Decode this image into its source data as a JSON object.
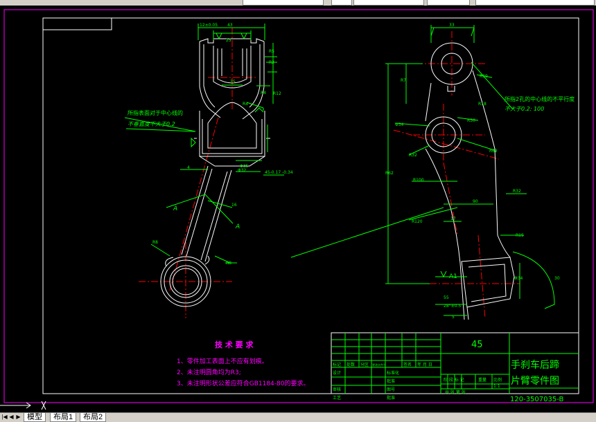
{
  "tabs": [
    "模型",
    "布局1",
    "布局2"
  ],
  "drawing": {
    "dims_left": [
      "12±0.05",
      "43",
      "25",
      "R5",
      "R2",
      "R4",
      "R12",
      "16",
      "45-0.17 -0.34",
      "45",
      "Φ32",
      "Φ35",
      "R8",
      "4",
      "A",
      "A"
    ],
    "dims_right": [
      "33",
      "R7",
      "R19",
      "R18",
      "R32",
      "R62",
      "R30",
      "Φ34",
      "R100",
      "R120",
      "90",
      "17",
      "R15",
      "30",
      "Φ34",
      "A1",
      "55",
      "28°±0.5",
      "5"
    ],
    "notes_left": [
      "所指表面对于中心线的",
      "不垂直度不大于0.2"
    ],
    "notes_right": [
      "所指2孔的中心线的不平行度",
      "不大于0.2: 100"
    ],
    "tech_title": "技 术 要 求",
    "tech_items": [
      "1、零件加工表面上不应有划痕。",
      "2、未注明圆角均为R3;",
      "3、未注明形状公差应符合GB1184-80的要求。"
    ],
    "title_block": {
      "material": "45",
      "name_line1": "手刹车后蹄",
      "name_line2": "片臂零件图",
      "drawing_no": "120-3507035-B",
      "row_labels": [
        "标记",
        "处数",
        "分区",
        "更改文件号",
        "签名",
        "年 月 日"
      ],
      "left_labels": [
        "设计",
        "审核",
        "工艺"
      ],
      "mid_labels": [
        "标准化",
        "批准",
        "图号",
        "标记"
      ],
      "stage_labels": [
        "阶 段 标 记",
        "重量",
        "比例"
      ],
      "scale": "1:1",
      "sheet": "共   张  第   张"
    }
  },
  "colors": {
    "bg": "#000000",
    "green": "#00ff00",
    "white": "#ffffff",
    "red": "#ff0000",
    "magenta": "#ff00ff",
    "yellow": "#ffff00",
    "cyan": "#00ffff"
  }
}
